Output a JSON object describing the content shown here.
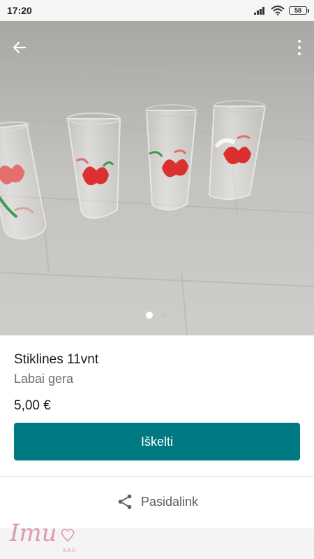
{
  "status_bar": {
    "time": "17:20",
    "battery": "58",
    "icons": [
      "signal-icon",
      "wifi-icon",
      "battery-icon"
    ]
  },
  "toolbar": {
    "back_icon": "arrow-left-icon",
    "menu_icon": "more-vert-icon"
  },
  "gallery": {
    "image_count": 2,
    "active_index": 0
  },
  "listing": {
    "title": "Stiklines 11vnt",
    "description": "Labai gera",
    "price": "5,00 €"
  },
  "actions": {
    "primary_label": "Iškelti",
    "share_label": "Pasidalink",
    "share_icon": "share-icon"
  },
  "watermark": {
    "text": "Imu",
    "subtext": "SAU"
  },
  "colors": {
    "accent": "#007a82",
    "dot_active": "#ffffff",
    "dot_inactive": "#c8c8c8"
  }
}
